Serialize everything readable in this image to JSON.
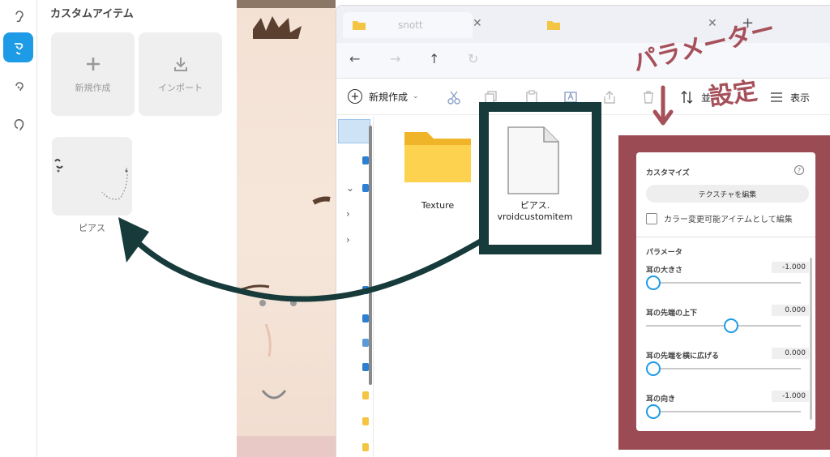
{
  "left_panel": {
    "title": "カスタムアイテム",
    "new_label": "新規作成",
    "import_label": "インポート",
    "item_label": "ピアス"
  },
  "explorer": {
    "tab_title": "snott",
    "new_label": "新規作成",
    "sort_label": "並",
    "view_label": "表示",
    "files": [
      {
        "name": "Texture",
        "kind": "folder"
      },
      {
        "name_line1": "ピアス.",
        "name_line2": "vroidcustomitem",
        "kind": "file"
      }
    ]
  },
  "annotation": {
    "line1": "パラメーター",
    "line2": "設定"
  },
  "customize": {
    "header": "カスタマイズ",
    "edit_texture": "テクスチャを編集",
    "color_checkbox_label": "カラー変更可能アイテムとして編集",
    "color_checkbox_checked": false,
    "params_header": "パラメータ",
    "params": [
      {
        "name": "耳の大きさ",
        "value": "-1.000",
        "level": 0.0
      },
      {
        "name": "耳の先端の上下",
        "value": "0.000",
        "level": 0.5
      },
      {
        "name": "耳の先端を横に広げる",
        "value": "0.000",
        "level": 0.0
      },
      {
        "name": "耳の向き",
        "value": "-1.000",
        "level": 0.0
      }
    ]
  },
  "colors": {
    "accent_blue": "#1e9be6",
    "annotation_red": "#9b4b53",
    "highlight_dark": "#173a3a",
    "arrow": "#173a3a"
  }
}
